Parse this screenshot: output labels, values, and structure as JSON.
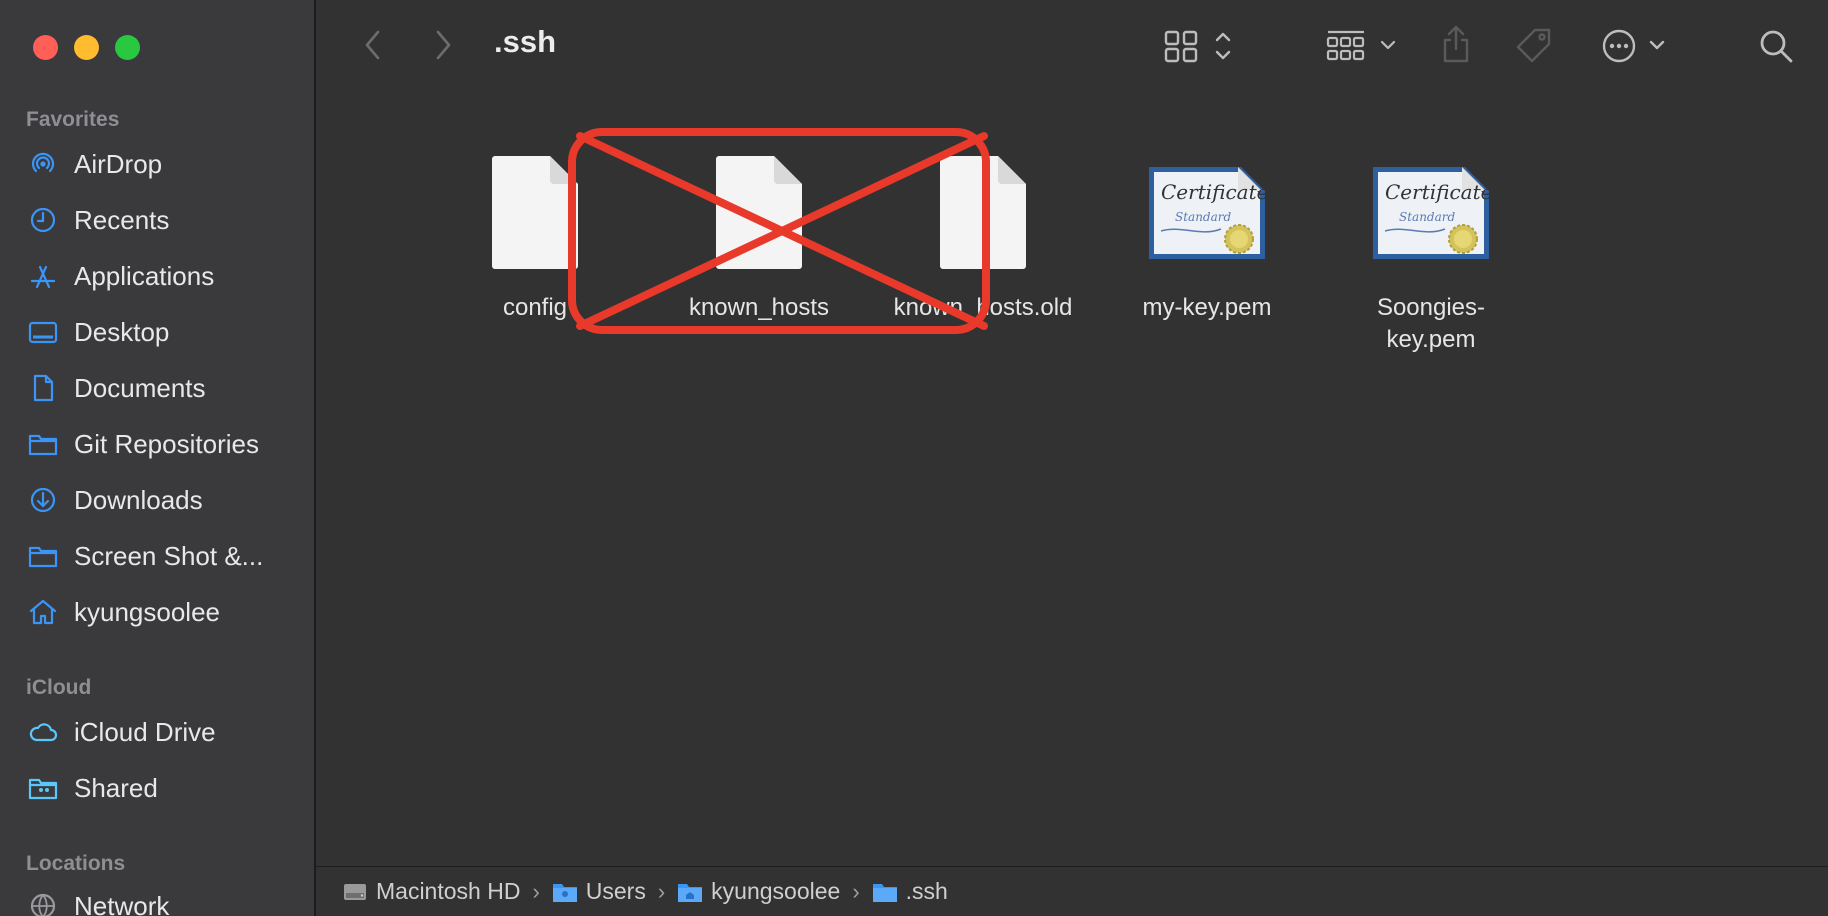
{
  "window": {
    "title": ".ssh"
  },
  "sidebar": {
    "favorites_header": "Favorites",
    "favorites": [
      {
        "label": "AirDrop",
        "icon": "airdrop-icon"
      },
      {
        "label": "Recents",
        "icon": "clock-icon"
      },
      {
        "label": "Applications",
        "icon": "applications-icon"
      },
      {
        "label": "Desktop",
        "icon": "desktop-icon"
      },
      {
        "label": "Documents",
        "icon": "document-icon"
      },
      {
        "label": "Git Repositories",
        "icon": "folder-icon"
      },
      {
        "label": "Downloads",
        "icon": "download-icon"
      },
      {
        "label": "Screen Shot &...",
        "icon": "folder-icon"
      },
      {
        "label": "kyungsoolee",
        "icon": "home-icon"
      }
    ],
    "icloud_header": "iCloud",
    "icloud": [
      {
        "label": "iCloud Drive",
        "icon": "cloud-icon"
      },
      {
        "label": "Shared",
        "icon": "shared-folder-icon"
      }
    ],
    "locations_header": "Locations",
    "locations": [
      {
        "label": "Network",
        "icon": "network-icon"
      }
    ]
  },
  "files": [
    {
      "name": "config",
      "type": "document"
    },
    {
      "name": "known_hosts",
      "type": "document"
    },
    {
      "name": "known_hosts.old",
      "type": "document"
    },
    {
      "name": "my-key.pem",
      "type": "certificate"
    },
    {
      "name": "Soongies-key.pem",
      "name_lines": [
        "Soongies-",
        "key.pem"
      ],
      "type": "certificate"
    }
  ],
  "certificate_text": {
    "line1": "Certificate",
    "line2": "Standard"
  },
  "annotation": {
    "color": "#e8392a",
    "marks": "cross-out of known_hosts and known_hosts.old"
  },
  "pathbar": [
    {
      "label": "Macintosh HD",
      "icon": "hard-drive-icon"
    },
    {
      "label": "Users",
      "icon": "users-folder-icon"
    },
    {
      "label": "kyungsoolee",
      "icon": "home-folder-icon"
    },
    {
      "label": ".ssh",
      "icon": "folder-icon"
    }
  ],
  "colors": {
    "accent": "#3a95f7",
    "sidebar_bg": "#3a3a3c",
    "main_bg": "#323232"
  }
}
